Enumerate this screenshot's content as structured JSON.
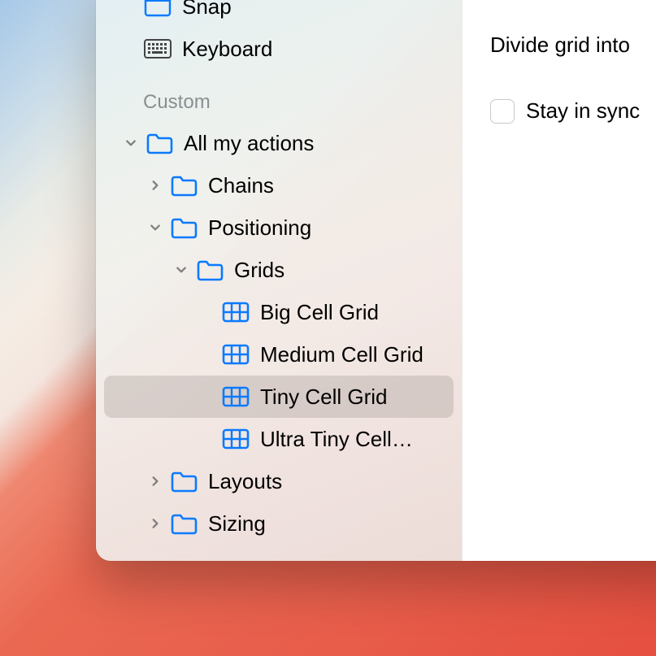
{
  "sidebar": {
    "top_items": [
      {
        "label": "Snap",
        "icon": "snap"
      },
      {
        "label": "Keyboard",
        "icon": "keyboard"
      }
    ],
    "section_label": "Custom",
    "tree": {
      "root_label": "All my actions",
      "children": [
        {
          "label": "Chains",
          "expanded": false,
          "icon": "folder"
        },
        {
          "label": "Positioning",
          "expanded": true,
          "icon": "folder",
          "children": [
            {
              "label": "Grids",
              "expanded": true,
              "icon": "folder",
              "children": [
                {
                  "label": "Big Cell Grid",
                  "icon": "grid",
                  "selected": false
                },
                {
                  "label": "Medium Cell Grid",
                  "icon": "grid",
                  "selected": false
                },
                {
                  "label": "Tiny Cell Grid",
                  "icon": "grid",
                  "selected": true
                },
                {
                  "label": "Ultra Tiny Cell…",
                  "icon": "grid",
                  "selected": false
                }
              ]
            }
          ]
        },
        {
          "label": "Layouts",
          "expanded": false,
          "icon": "folder"
        },
        {
          "label": "Sizing",
          "expanded": false,
          "icon": "folder"
        }
      ]
    }
  },
  "main": {
    "divide_label": "Divide grid into",
    "sync_label": "Stay in sync"
  },
  "colors": {
    "accent_blue": "#0a7aff",
    "folder_blue": "#0a7aff"
  }
}
